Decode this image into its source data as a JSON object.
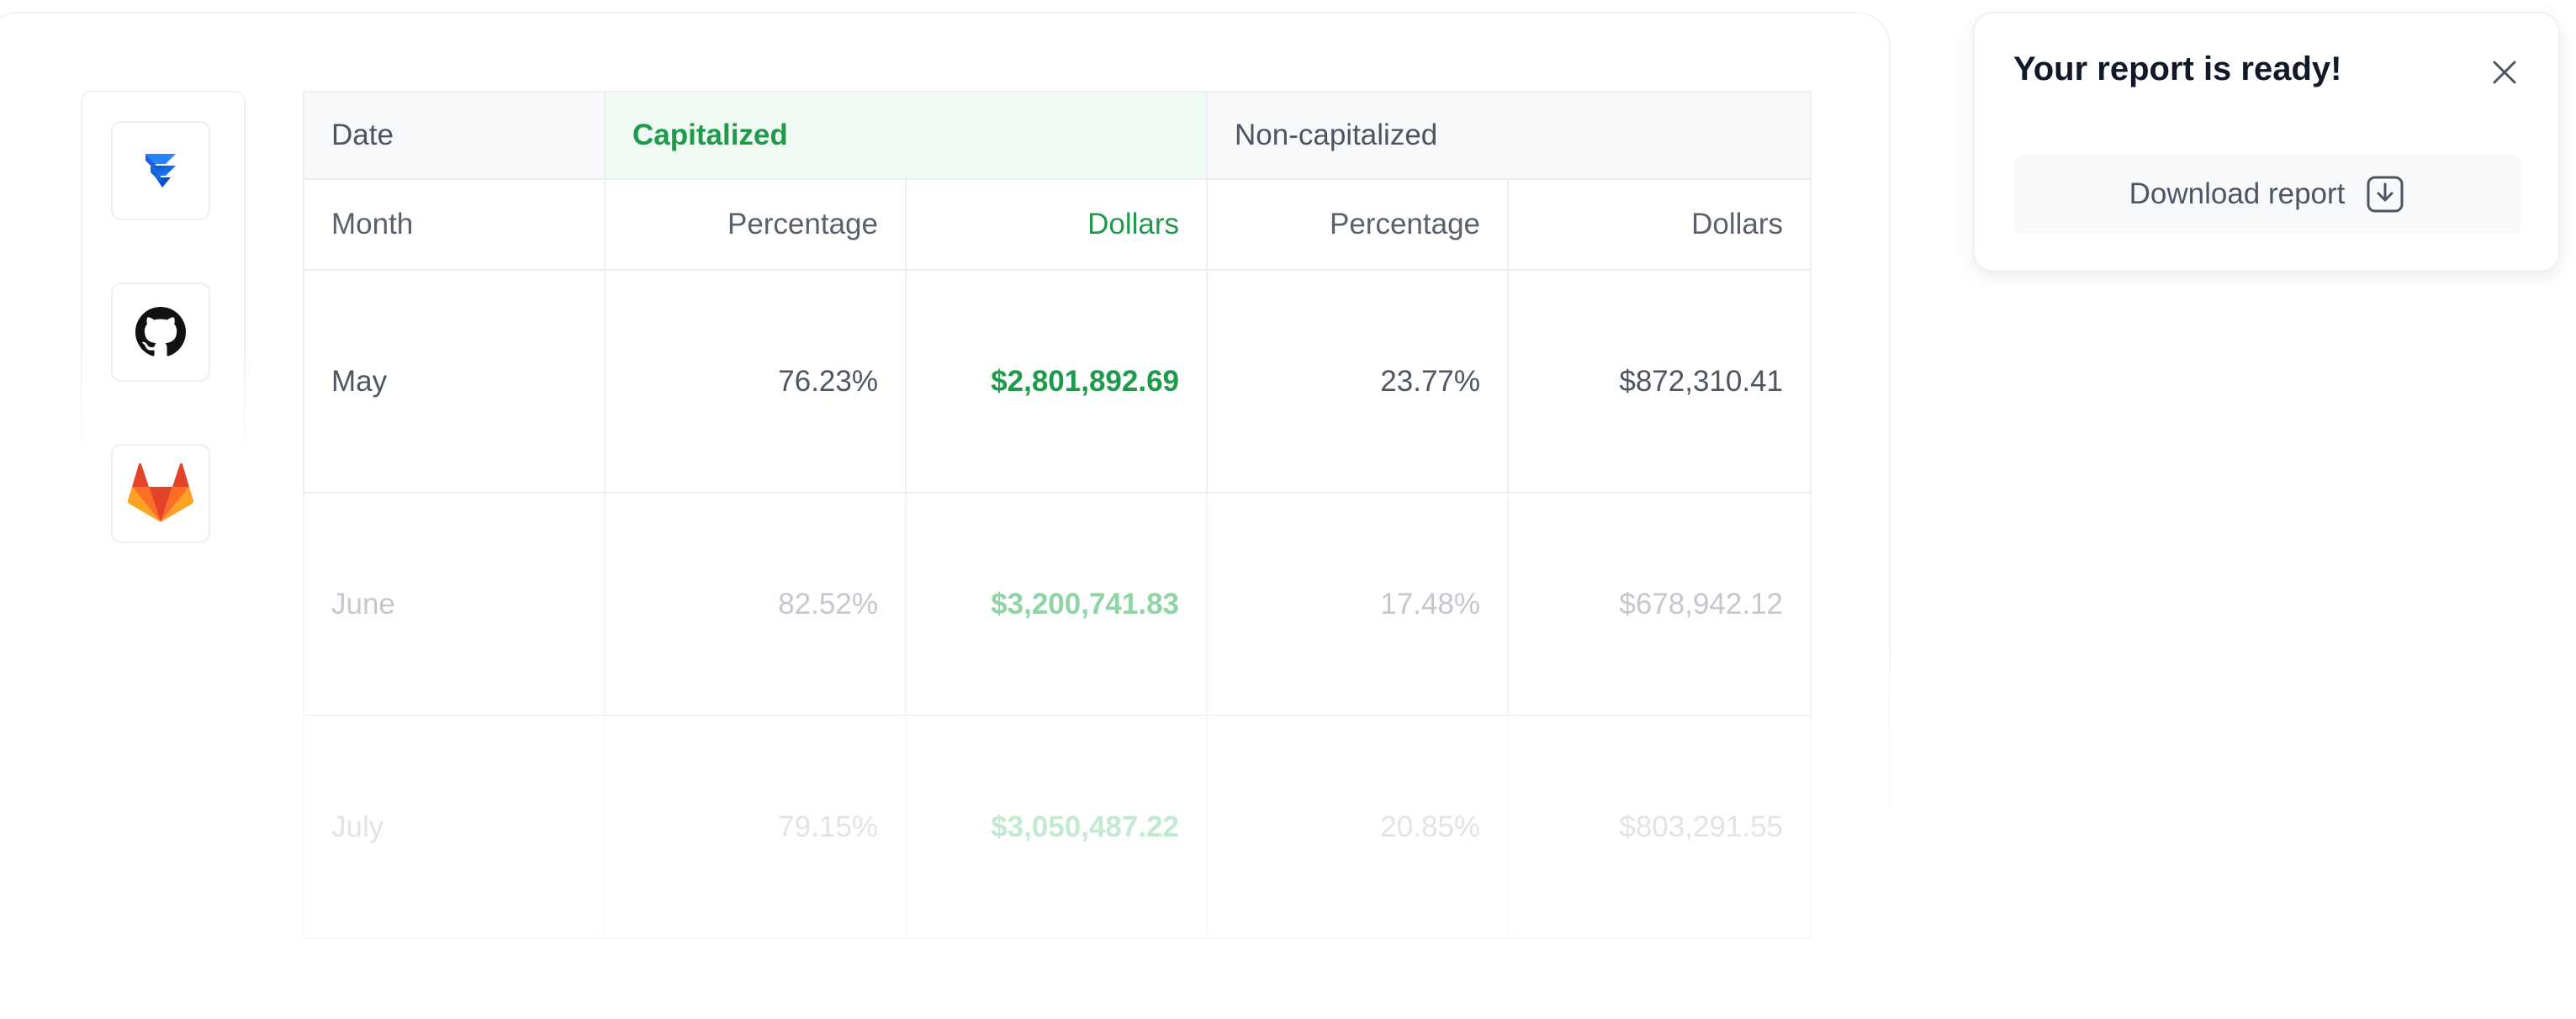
{
  "integrations": {
    "items": [
      {
        "name": "jira",
        "icon": "jira-icon",
        "color": "#2684ff"
      },
      {
        "name": "github",
        "icon": "github-icon",
        "color": "#111111"
      },
      {
        "name": "gitlab",
        "icon": "gitlab-icon",
        "color": "#e24329"
      }
    ]
  },
  "table": {
    "group_headers": {
      "date": "Date",
      "capitalized": "Capitalized",
      "non_capitalized": "Non-capitalized"
    },
    "column_headers": {
      "month": "Month",
      "cap_percentage": "Percentage",
      "cap_dollars": "Dollars",
      "noncap_percentage": "Percentage",
      "noncap_dollars": "Dollars"
    },
    "rows": [
      {
        "month": "May",
        "cap_percentage": "76.23%",
        "cap_dollars": "$2,801,892.69",
        "noncap_percentage": "23.77%",
        "noncap_dollars": "$872,310.41"
      },
      {
        "month": "June",
        "cap_percentage": "82.52%",
        "cap_dollars": "$3,200,741.83",
        "noncap_percentage": "17.48%",
        "noncap_dollars": "$678,942.12"
      },
      {
        "month": "July",
        "cap_percentage": "79.15%",
        "cap_dollars": "$3,050,487.22",
        "noncap_percentage": "20.85%",
        "noncap_dollars": "$803,291.55"
      }
    ],
    "accent_color": "#1f9a4b"
  },
  "toast": {
    "title": "Your report is ready!",
    "close_icon": "close-icon",
    "download_label": "Download report",
    "download_icon": "download-icon"
  }
}
